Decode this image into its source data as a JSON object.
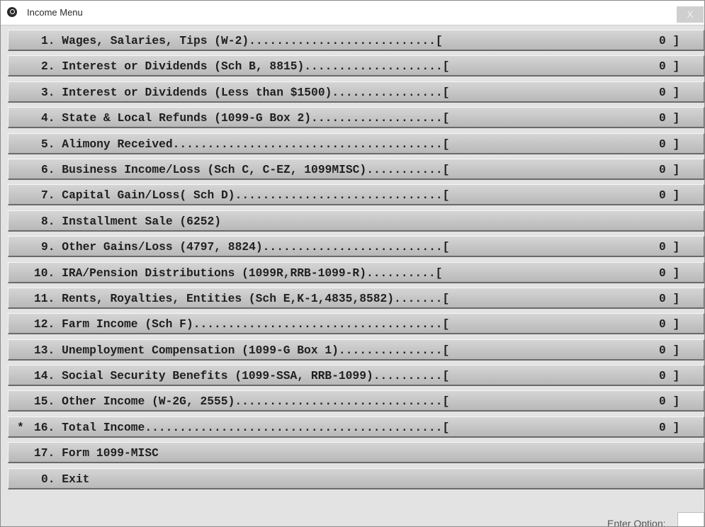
{
  "window": {
    "title": "Income Menu",
    "close_label": "X"
  },
  "menu": {
    "items": [
      {
        "marker": "",
        "label": "1. Wages, Salaries, Tips (W-2)...........................[",
        "value": "0 ]"
      },
      {
        "marker": "",
        "label": "2. Interest or Dividends (Sch B, 8815)....................[",
        "value": "0 ]"
      },
      {
        "marker": "",
        "label": "3. Interest or Dividends (Less than $1500)................[",
        "value": "0 ]"
      },
      {
        "marker": "",
        "label": "4. State & Local Refunds (1099-G Box 2)...................[",
        "value": "0 ]"
      },
      {
        "marker": "",
        "label": "5. Alimony Received.......................................[",
        "value": "0 ]"
      },
      {
        "marker": "",
        "label": "6. Business Income/Loss (Sch C, C-EZ, 1099MISC)...........[",
        "value": "0 ]"
      },
      {
        "marker": "",
        "label": "7. Capital Gain/Loss( Sch D)..............................[",
        "value": "0 ]"
      },
      {
        "marker": "",
        "label": "8. Installment Sale (6252)",
        "value": ""
      },
      {
        "marker": "",
        "label": "9. Other Gains/Loss (4797, 8824)..........................[",
        "value": "0 ]"
      },
      {
        "marker": "",
        "label": "10. IRA/Pension Distributions (1099R,RRB-1099-R)..........[",
        "value": "0 ]"
      },
      {
        "marker": "",
        "label": "11. Rents, Royalties, Entities (Sch E,K-1,4835,8582).......[",
        "value": "0 ]"
      },
      {
        "marker": "",
        "label": "12. Farm Income (Sch F)....................................[",
        "value": "0 ]"
      },
      {
        "marker": "",
        "label": "13. Unemployment Compensation (1099-G Box 1)...............[",
        "value": "0 ]"
      },
      {
        "marker": "",
        "label": "14. Social Security Benefits (1099-SSA, RRB-1099)..........[",
        "value": "0 ]"
      },
      {
        "marker": "",
        "label": "15. Other Income (W-2G, 2555)..............................[",
        "value": "0 ]"
      },
      {
        "marker": "*",
        "label": "16. Total Income...........................................[",
        "value": "0 ]"
      },
      {
        "marker": "",
        "label": "17. Form 1099-MISC",
        "value": ""
      },
      {
        "marker": "",
        "label": "0. Exit",
        "value": ""
      }
    ]
  },
  "footer": {
    "option_label": "Enter Option:",
    "option_value": ""
  }
}
